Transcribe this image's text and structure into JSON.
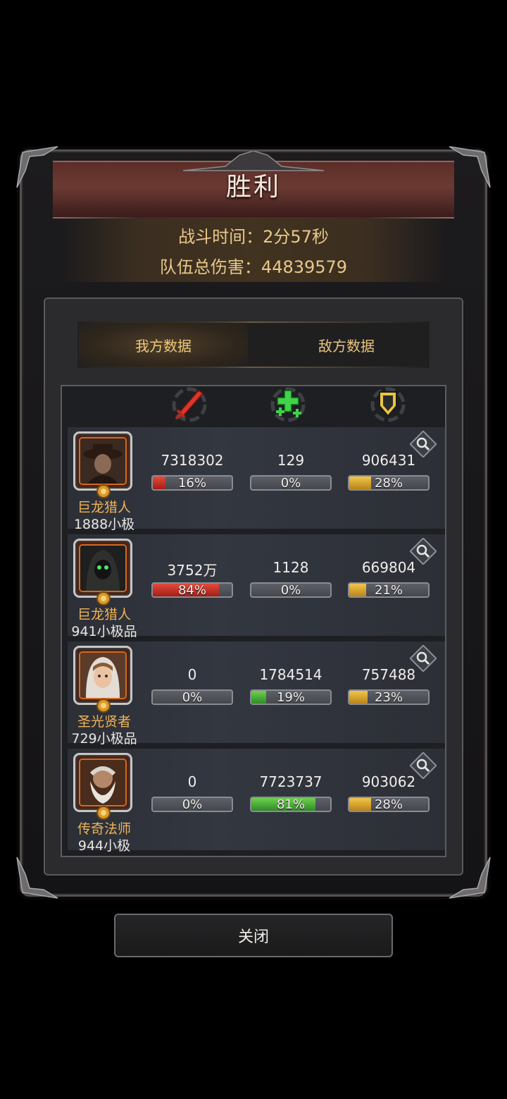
{
  "header": {
    "title": "胜利",
    "battle_time": "战斗时间：2分57秒",
    "team_damage": "队伍总伤害：44839579"
  },
  "tabs": [
    {
      "label": "我方数据",
      "active": true
    },
    {
      "label": "敌方数据",
      "active": false
    }
  ],
  "columns": [
    {
      "icon": "sword-damage-icon",
      "color": "#d8382c"
    },
    {
      "icon": "heal-cross-icon",
      "color": "#3fd34a"
    },
    {
      "icon": "shield-tank-icon",
      "color": "#e8c640"
    }
  ],
  "heroes": [
    {
      "name": "巨龙猎人",
      "level": "1888小极",
      "damage": "7318302",
      "damage_pct": "16%",
      "damage_frac": 0.16,
      "heal": "129",
      "heal_pct": "0%",
      "heal_frac": 0,
      "tank": "906431",
      "tank_pct": "28%",
      "tank_frac": 0.28
    },
    {
      "name": "巨龙猎人",
      "level": "941小极品",
      "damage": "3752万",
      "damage_pct": "84%",
      "damage_frac": 0.84,
      "heal": "1128",
      "heal_pct": "0%",
      "heal_frac": 0,
      "tank": "669804",
      "tank_pct": "21%",
      "tank_frac": 0.21
    },
    {
      "name": "圣光贤者",
      "level": "729小极品",
      "damage": "0",
      "damage_pct": "0%",
      "damage_frac": 0,
      "heal": "1784514",
      "heal_pct": "19%",
      "heal_frac": 0.19,
      "tank": "757488",
      "tank_pct": "23%",
      "tank_frac": 0.23
    },
    {
      "name": "传奇法师",
      "level": "944小极",
      "damage": "0",
      "damage_pct": "0%",
      "damage_frac": 0,
      "heal": "7723737",
      "heal_pct": "81%",
      "heal_frac": 0.81,
      "tank": "903062",
      "tank_pct": "28%",
      "tank_frac": 0.28
    }
  ],
  "footer": {
    "close_label": "关闭"
  }
}
